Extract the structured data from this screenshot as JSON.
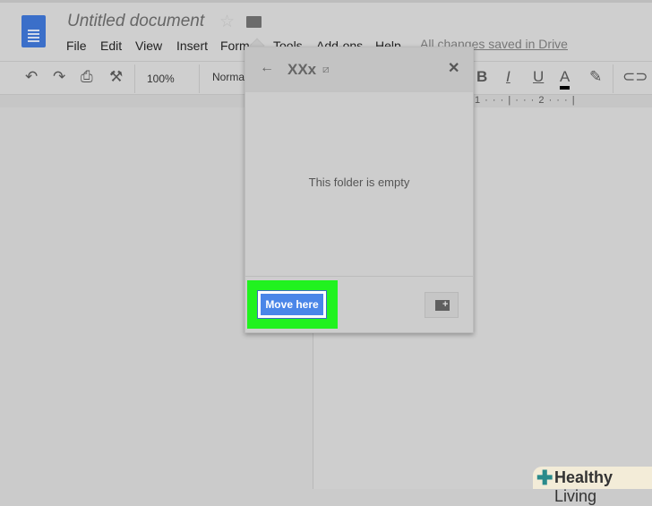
{
  "header": {
    "title": "Untitled document",
    "menu": [
      "File",
      "Edit",
      "View",
      "Insert",
      "Format",
      "Tools",
      "Add-ons",
      "Help"
    ],
    "saved_status": "All changes saved in Drive"
  },
  "toolbar": {
    "zoom": "100%",
    "style": "Normal text",
    "bold": "B",
    "italic": "I",
    "underline": "U",
    "text_color": "A"
  },
  "ruler": {
    "marks": "1 · · · | · · · 2 · · · |"
  },
  "dialog": {
    "folder_name": "XXx",
    "empty_message": "This folder is empty",
    "move_button": "Move here",
    "back_icon": "arrow-left-icon",
    "close_icon": "close-icon",
    "new_folder_icon": "folder-plus-icon"
  },
  "watermark": {
    "bold": "Healthy",
    "rest": " Living"
  },
  "colors": {
    "move_button": "#4a86e8",
    "highlight": "#21f21f",
    "doc_icon": "#3b6fc9"
  }
}
